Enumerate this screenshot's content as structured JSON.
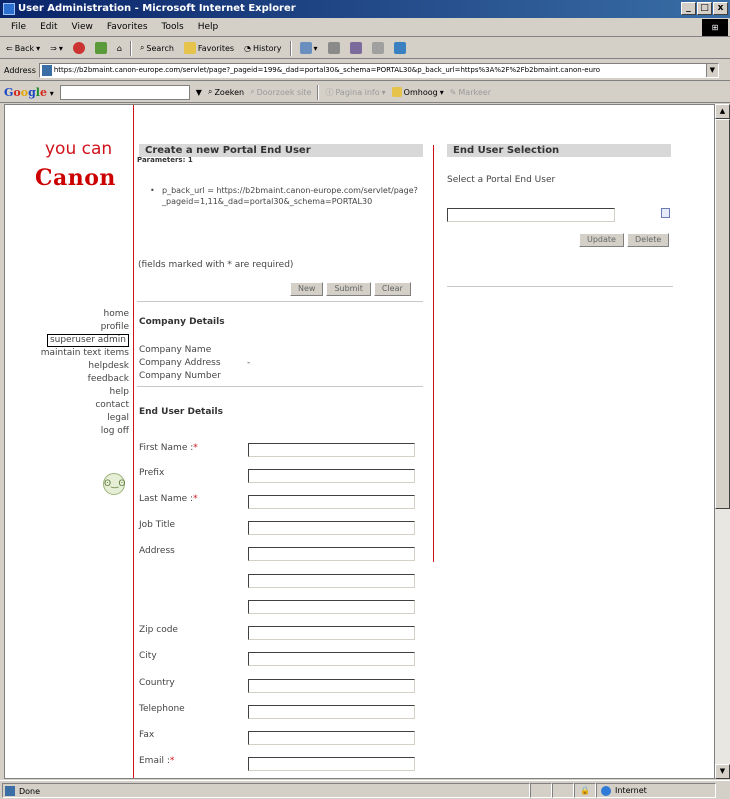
{
  "window": {
    "title": "User Administration - Microsoft Internet Explorer",
    "min": "_",
    "max": "□",
    "close": "x"
  },
  "menu": [
    "File",
    "Edit",
    "View",
    "Favorites",
    "Tools",
    "Help"
  ],
  "toolbar": {
    "back": "Back",
    "search": "Search",
    "favorites": "Favorites",
    "history": "History"
  },
  "address": {
    "label": "Address",
    "url": "https://b2bmaint.canon-europe.com/servlet/page?_pageid=199&_dad=portal30&_schema=PORTAL30&p_back_url=https%3A%2F%2Fb2bmaint.canon-euro"
  },
  "googlebar": {
    "logo": "Google",
    "zoeken": "Zoeken",
    "doorzoek": "Doorzoek site",
    "pagina": "Pagina info",
    "omhoog": "Omhoog",
    "markeer": "Markeer"
  },
  "brand": {
    "tagline": "you can",
    "name": "Canon"
  },
  "nav": [
    "home",
    "profile",
    "superuser admin",
    "maintain text items",
    "helpdesk",
    "feedback",
    "help",
    "contact",
    "legal",
    "log off"
  ],
  "create": {
    "title": "Create a new Portal End User",
    "params": "Parameters: 1",
    "param_line": "p_back_url = https://b2bmaint.canon-europe.com/servlet/page?_pageid=1,11&_dad=portal30&_schema=PORTAL30",
    "required_note": "(fields marked with * are required)",
    "btn_new": "New",
    "btn_submit": "Submit",
    "btn_clear": "Clear"
  },
  "company": {
    "title": "Company Details",
    "name_label": "Company Name",
    "address_label": "Company Address",
    "address_value": "-",
    "number_label": "Company Number"
  },
  "enduser": {
    "title": "End User Details",
    "fields": {
      "first": "First Name :",
      "prefix": "Prefix",
      "last": "Last Name :",
      "job": "Job Title",
      "address": "Address",
      "zip": "Zip code",
      "city": "City",
      "country": "Country",
      "telephone": "Telephone",
      "fax": "Fax",
      "email": "Email :"
    },
    "star": "*"
  },
  "selection": {
    "title": "End User Selection",
    "prompt": "Select a Portal End User",
    "btn_update": "Update",
    "btn_delete": "Delete"
  },
  "status": {
    "done": "Done",
    "zone": "Internet"
  }
}
